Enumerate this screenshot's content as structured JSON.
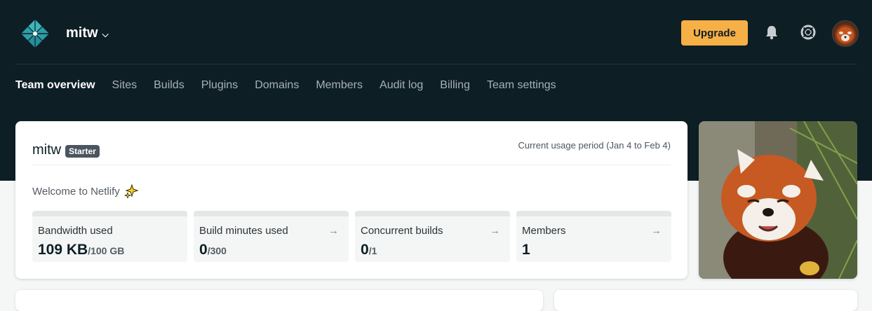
{
  "app": {
    "team_name": "mitw",
    "upgrade_label": "Upgrade",
    "brand_color": "#0e1e25",
    "accent_color": "#f7b046"
  },
  "header_icons": {
    "notifications": "bell-icon",
    "help": "lifebuoy-icon",
    "avatar": "user-avatar"
  },
  "nav": {
    "items": [
      {
        "label": "Team overview",
        "active": true
      },
      {
        "label": "Sites"
      },
      {
        "label": "Builds"
      },
      {
        "label": "Plugins"
      },
      {
        "label": "Domains"
      },
      {
        "label": "Members"
      },
      {
        "label": "Audit log"
      },
      {
        "label": "Billing"
      },
      {
        "label": "Team settings"
      }
    ]
  },
  "overview": {
    "team_name": "mitw",
    "plan_badge": "Starter",
    "usage_period": "Current usage period (Jan 4 to Feb 4)",
    "welcome": "Welcome to Netlify",
    "welcome_icon": "sparkles-icon",
    "stats": [
      {
        "label": "Bandwidth used",
        "value": "109 KB",
        "limit": "/100 GB",
        "has_link": false
      },
      {
        "label": "Build minutes used",
        "value": "0",
        "limit": "/300",
        "has_link": true,
        "arrow": "→"
      },
      {
        "label": "Concurrent builds",
        "value": "0",
        "limit": "/1",
        "has_link": true,
        "arrow": "→"
      },
      {
        "label": "Members",
        "value": "1",
        "limit": "",
        "has_link": true,
        "arrow": "→"
      }
    ]
  },
  "promo_image": "red-panda-photo"
}
